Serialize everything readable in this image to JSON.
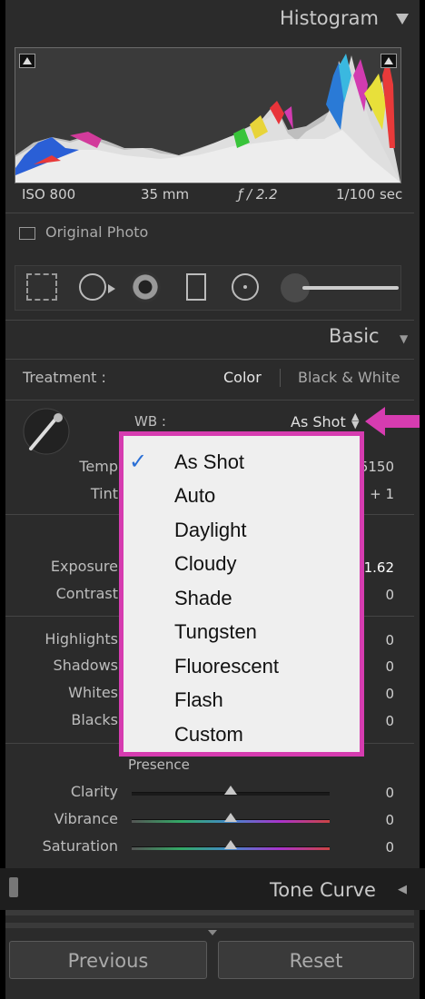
{
  "histogram": {
    "title": "Histogram",
    "iso": "ISO 800",
    "focal_length": "35 mm",
    "aperture": "ƒ / 2.2",
    "shutter": "1/100 sec",
    "original_photo_label": "Original Photo"
  },
  "basic": {
    "title": "Basic",
    "treatment_label": "Treatment :",
    "treatment_color": "Color",
    "treatment_bw": "Black & White",
    "wb_label": "WB :",
    "wb_value": "As Shot",
    "temp_label": "Temp",
    "temp_value": "5150",
    "tint_label": "Tint",
    "tint_value": "+ 1",
    "exposure_label": "Exposure",
    "exposure_value": "1.62",
    "contrast_label": "Contrast",
    "contrast_value": "0",
    "highlights_label": "Highlights",
    "highlights_value": "0",
    "shadows_label": "Shadows",
    "shadows_value": "0",
    "whites_label": "Whites",
    "whites_value": "0",
    "blacks_label": "Blacks",
    "blacks_value": "0",
    "presence_label": "Presence",
    "clarity_label": "Clarity",
    "clarity_value": "0",
    "vibrance_label": "Vibrance",
    "vibrance_value": "0",
    "saturation_label": "Saturation",
    "saturation_value": "0"
  },
  "wb_menu": {
    "items": [
      "As Shot",
      "Auto",
      "Daylight",
      "Cloudy",
      "Shade",
      "Tungsten",
      "Fluorescent",
      "Flash",
      "Custom"
    ],
    "selected": "As Shot"
  },
  "tone_curve": {
    "title": "Tone Curve"
  },
  "buttons": {
    "previous": "Previous",
    "reset": "Reset"
  },
  "colors": {
    "highlight_border": "#d63cb0",
    "panel_bg": "#2b2b2b",
    "menu_bg": "#efefef"
  }
}
